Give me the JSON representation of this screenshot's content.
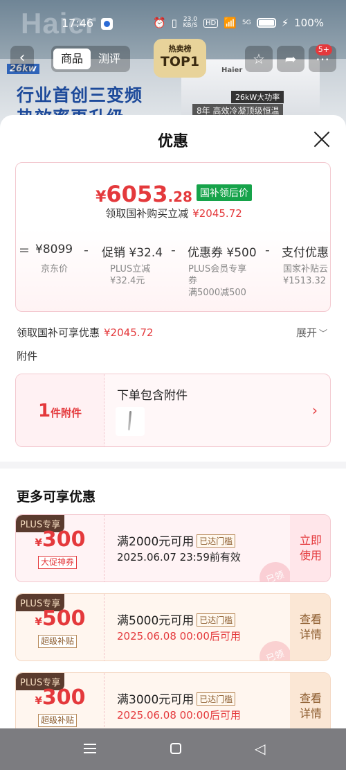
{
  "status_bar": {
    "time": "17:46",
    "network_speed": "23.0 KB/S",
    "hd": "HD",
    "signal": "5G",
    "battery": "100%"
  },
  "background_page": {
    "logo": "Haier",
    "top_badge_line1": "热卖榜",
    "top_badge_line2": "TOP1",
    "badge_kw": "26kw",
    "headline_line1": "行业首创三变频",
    "headline_line2": "热效率再升级",
    "product_brand": "Haier",
    "feature_tag": "26kW大功率",
    "note_tag": "8年  高效冷凝顶级恒温"
  },
  "top_bar": {
    "tabs": [
      {
        "label": "商品",
        "active": true
      },
      {
        "label": "测评",
        "active": false
      }
    ],
    "cart_badge": "5+",
    "icons": [
      "back-icon",
      "star-icon",
      "share-icon",
      "more-icon"
    ]
  },
  "sheet": {
    "title": "优惠",
    "price_card": {
      "yen": "¥",
      "price_int": "6053",
      "price_dec": ".28",
      "tag": "国补领后价",
      "subtitle": "领取国补购买立减",
      "subtitle_amount": "¥2045.72",
      "calc": [
        {
          "op": "=",
          "value": "¥8099",
          "label": "京东价"
        },
        {
          "op": "-",
          "value": "促销 ¥32.4",
          "label": "PLUS立减\n¥32.4元"
        },
        {
          "op": "-",
          "value": "优惠券 ¥500",
          "label": "PLUS会员专享\n券\n满5000减500"
        },
        {
          "op": "-",
          "value": "支付优惠",
          "label": "国家补贴云\n¥1513.32"
        }
      ]
    },
    "discount_row": {
      "label": "领取国补可享优惠",
      "amount": "¥2045.72",
      "expand": "展开"
    },
    "attachments": {
      "heading": "附件",
      "count": "1",
      "count_unit": "件附件",
      "title": "下单包含附件"
    },
    "more_title": "更多可享优惠",
    "coupons": [
      {
        "plus": "PLUS专享",
        "yen": "¥",
        "amount": "300",
        "kind": "大促神券",
        "condition": "满2000元可用",
        "tag": "已达门槛",
        "time": "2025.06.07 23:59前有效",
        "action": "立即\n使用",
        "stamp": "已领",
        "style": "pink"
      },
      {
        "plus": "PLUS专享",
        "yen": "¥",
        "amount": "500",
        "kind": "超级补贴",
        "condition": "满5000元可用",
        "tag": "已达门槛",
        "time": "2025.06.08 00:00后可用",
        "action": "查看\n详情",
        "stamp": "已领",
        "style": "peach"
      },
      {
        "plus": "PLUS专享",
        "yen": "¥",
        "amount": "300",
        "kind": "超级补贴",
        "condition": "满3000元可用",
        "tag": "已达门槛",
        "time": "2025.06.08 00:00后可用",
        "action": "查看\n详情",
        "stamp": "",
        "style": "peach"
      }
    ]
  },
  "colors": {
    "accent_red": "#e4393c",
    "tag_green": "#16a34a",
    "plus_brown": "#5a3b2e"
  }
}
